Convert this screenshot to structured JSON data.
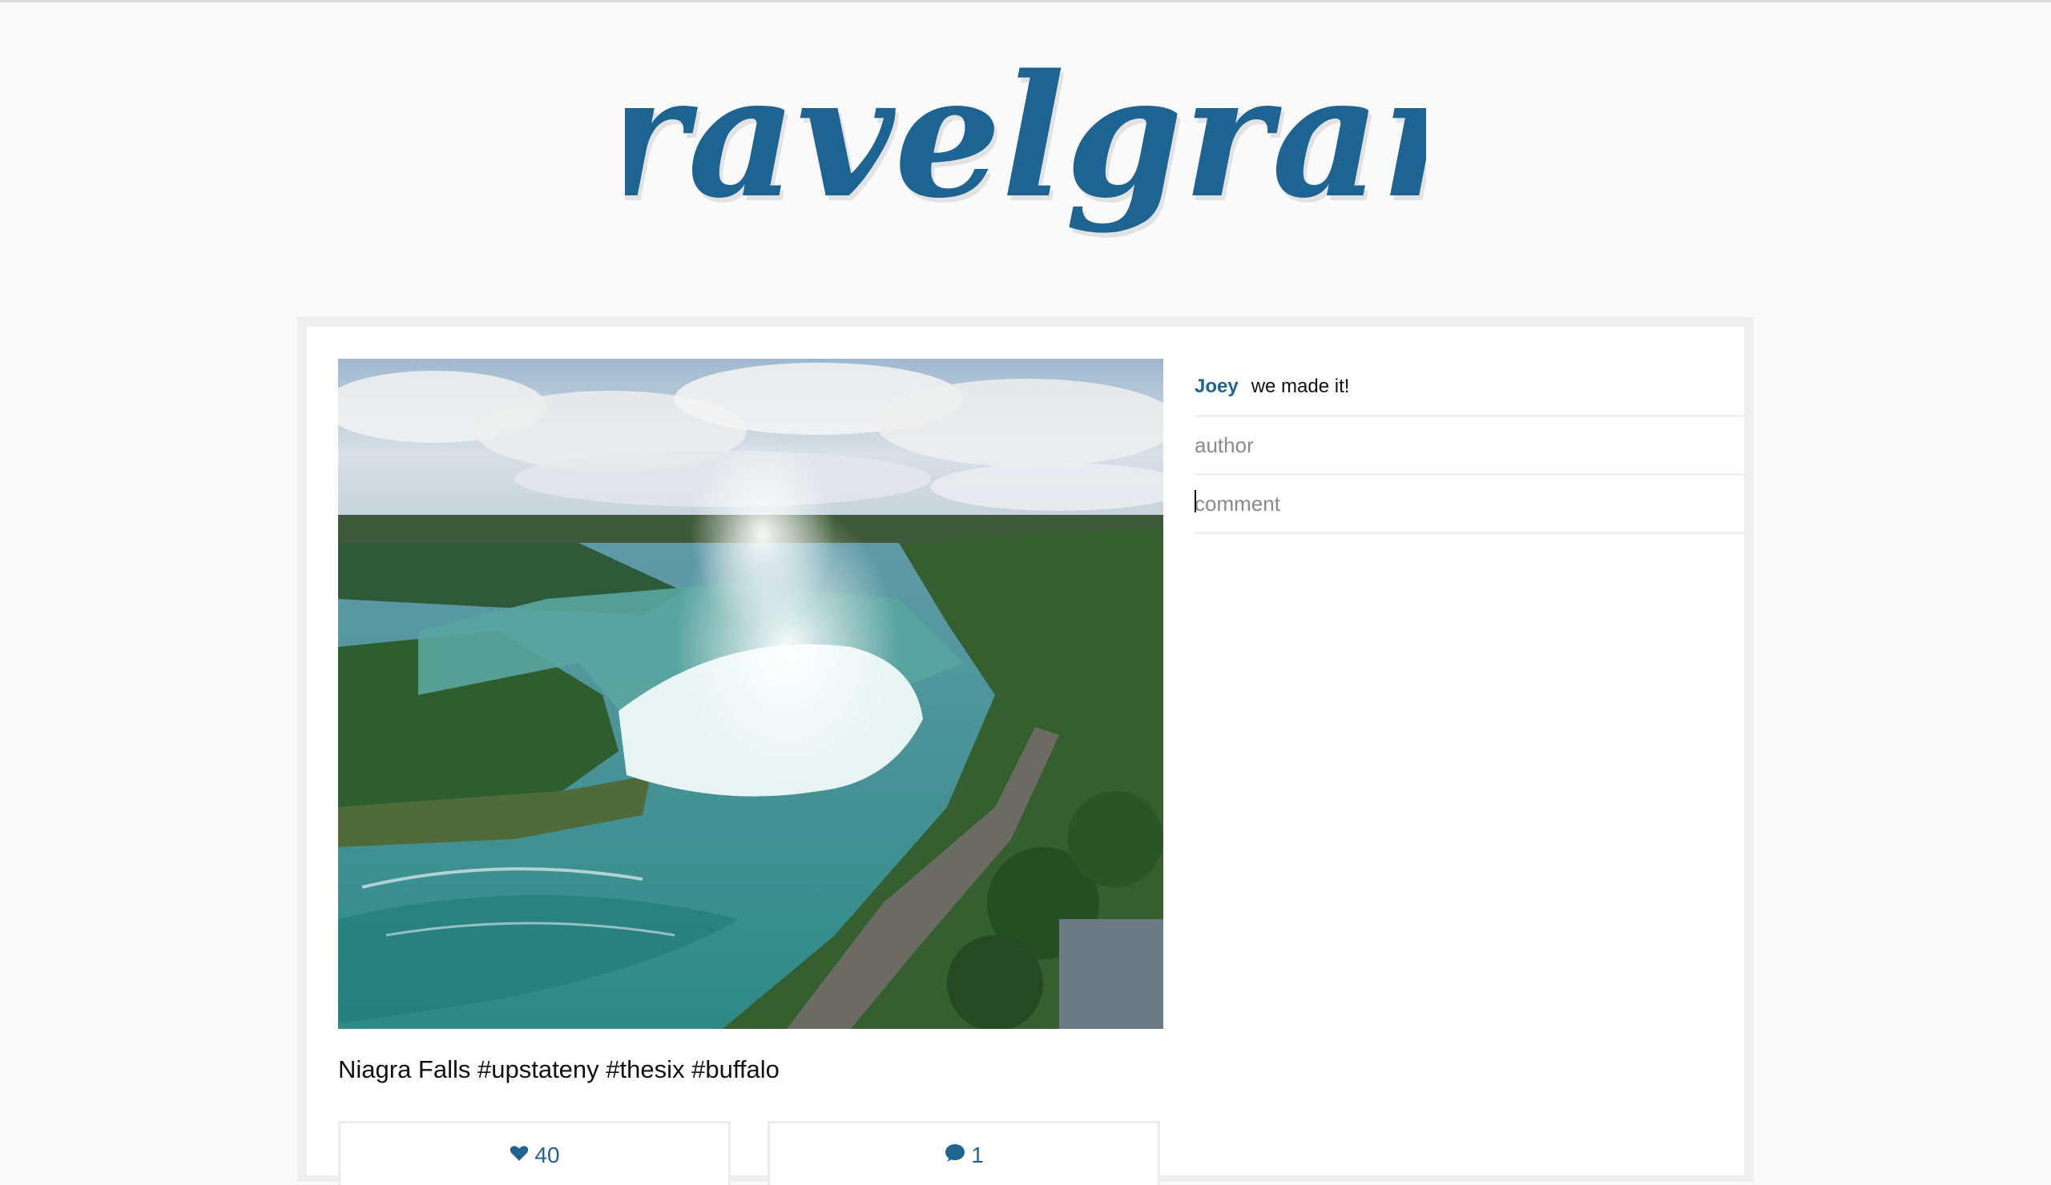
{
  "app": {
    "logo_text": "Travelgram",
    "brand_color": "#1e6493"
  },
  "post": {
    "caption": "Niagra Falls #upstateny #thesix #buffalo",
    "likes": "40",
    "comments_count": "1",
    "image_subject": "Aerial view of Niagara Falls (Horseshoe Falls)"
  },
  "comments": [
    {
      "author": "Joey",
      "text": "we made it!"
    }
  ],
  "form": {
    "author_placeholder": "author",
    "comment_placeholder": "comment"
  },
  "icons": {
    "like": "heart-icon",
    "comment": "speech-bubble-icon"
  }
}
